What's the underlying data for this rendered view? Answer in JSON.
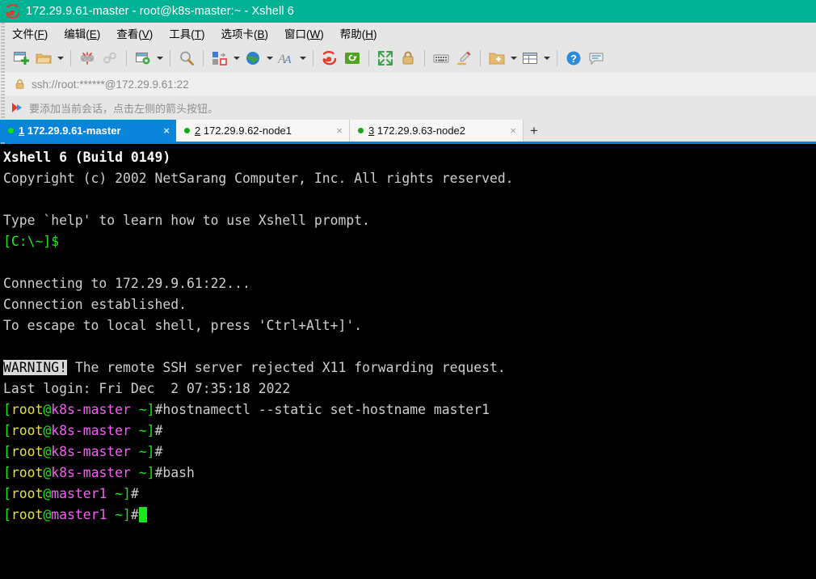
{
  "window": {
    "title": "172.29.9.61-master - root@k8s-master:~ - Xshell 6",
    "logo_icon": "xshell-spiral-logo",
    "titlebar_color": "#00b394"
  },
  "menubar": {
    "items": [
      {
        "name": "file",
        "pre": "文件(",
        "key": "F",
        "post": ")"
      },
      {
        "name": "edit",
        "pre": "编辑(",
        "key": "E",
        "post": ")"
      },
      {
        "name": "view",
        "pre": "查看(",
        "key": "V",
        "post": ")"
      },
      {
        "name": "tools",
        "pre": "工具(",
        "key": "T",
        "post": ")"
      },
      {
        "name": "tabs",
        "pre": "选项卡(",
        "key": "B",
        "post": ")"
      },
      {
        "name": "window",
        "pre": "窗口(",
        "key": "W",
        "post": ")"
      },
      {
        "name": "help",
        "pre": "帮助(",
        "key": "H",
        "post": ")"
      }
    ]
  },
  "toolbar": {
    "buttons": [
      {
        "icon": "new-session-icon",
        "dropdown": false
      },
      {
        "icon": "open-folder-icon",
        "dropdown": true
      },
      {
        "sep": true
      },
      {
        "icon": "disconnect-icon",
        "dropdown": false
      },
      {
        "icon": "reconnect-icon",
        "dropdown": false
      },
      {
        "sep": true
      },
      {
        "icon": "session-properties-icon",
        "dropdown": true
      },
      {
        "sep": true
      },
      {
        "icon": "find-icon",
        "dropdown": false
      },
      {
        "sep": true
      },
      {
        "icon": "layout-transfer-icon",
        "dropdown": true
      },
      {
        "icon": "globe-icon",
        "dropdown": true
      },
      {
        "icon": "font-icon",
        "dropdown": true
      },
      {
        "sep": true
      },
      {
        "icon": "xshell-logo-icon",
        "dropdown": false
      },
      {
        "icon": "xftp-icon",
        "dropdown": false
      },
      {
        "sep": true
      },
      {
        "icon": "fullscreen-icon",
        "dropdown": false
      },
      {
        "icon": "lock-icon",
        "dropdown": false
      },
      {
        "sep": true
      },
      {
        "icon": "keyboard-icon",
        "dropdown": false
      },
      {
        "icon": "highlight-pen-icon",
        "dropdown": false
      },
      {
        "sep": true
      },
      {
        "icon": "add-folder-icon",
        "dropdown": true
      },
      {
        "icon": "split-view-icon",
        "dropdown": true
      },
      {
        "sep": true
      },
      {
        "icon": "help-icon",
        "dropdown": false
      },
      {
        "icon": "chat-icon",
        "dropdown": false
      }
    ]
  },
  "address_bar": {
    "lock_icon": "lock-icon",
    "value": "ssh://root:******@172.29.9.61:22"
  },
  "hint_bar": {
    "icon": "red-arrow-icon",
    "text": "要添加当前会话，点击左侧的箭头按钮。"
  },
  "tabs": {
    "items": [
      {
        "index": "1",
        "label": "172.29.9.61-master",
        "active": true,
        "close": "×",
        "status": "connected"
      },
      {
        "index": "2",
        "label": "172.29.9.62-node1",
        "active": false,
        "close": "×",
        "status": "connected"
      },
      {
        "index": "3",
        "label": "172.29.9.63-node2",
        "active": false,
        "close": "×",
        "status": "connected"
      }
    ],
    "add_label": "+",
    "active_color": "#0a84d8"
  },
  "terminal": {
    "background": "#000000",
    "lines": [
      [
        {
          "t": "Xshell 6 (Build 0149)",
          "c": "bwhite"
        }
      ],
      [
        {
          "t": "Copyright (c) 2002 NetSarang Computer, Inc. All rights reserved.",
          "c": "white"
        }
      ],
      [
        {
          "t": "",
          "c": "white"
        }
      ],
      [
        {
          "t": "Type `help' to learn how to use Xshell prompt.",
          "c": "white"
        }
      ],
      [
        {
          "t": "[C:\\~]$",
          "c": "green"
        }
      ],
      [
        {
          "t": "",
          "c": "white"
        }
      ],
      [
        {
          "t": "Connecting to 172.29.9.61:22...",
          "c": "white"
        }
      ],
      [
        {
          "t": "Connection established.",
          "c": "white"
        }
      ],
      [
        {
          "t": "To escape to local shell, press 'Ctrl+Alt+]'.",
          "c": "white"
        }
      ],
      [
        {
          "t": "",
          "c": "white"
        }
      ],
      [
        {
          "t": "WARNING!",
          "c": "inv"
        },
        {
          "t": " The remote SSH server rejected X11 forwarding request.",
          "c": "white"
        }
      ],
      [
        {
          "t": "Last login: Fri Dec  2 07:35:18 2022",
          "c": "white"
        }
      ],
      [
        {
          "t": "[",
          "c": "green"
        },
        {
          "t": "root",
          "c": "yellow"
        },
        {
          "t": "@",
          "c": "green"
        },
        {
          "t": "k8s-master",
          "c": "magenta"
        },
        {
          "t": " ~]",
          "c": "green"
        },
        {
          "t": "#hostnamectl --static set-hostname master1",
          "c": "white"
        }
      ],
      [
        {
          "t": "[",
          "c": "green"
        },
        {
          "t": "root",
          "c": "yellow"
        },
        {
          "t": "@",
          "c": "green"
        },
        {
          "t": "k8s-master",
          "c": "magenta"
        },
        {
          "t": " ~]",
          "c": "green"
        },
        {
          "t": "#",
          "c": "white"
        }
      ],
      [
        {
          "t": "[",
          "c": "green"
        },
        {
          "t": "root",
          "c": "yellow"
        },
        {
          "t": "@",
          "c": "green"
        },
        {
          "t": "k8s-master",
          "c": "magenta"
        },
        {
          "t": " ~]",
          "c": "green"
        },
        {
          "t": "#",
          "c": "white"
        }
      ],
      [
        {
          "t": "[",
          "c": "green"
        },
        {
          "t": "root",
          "c": "yellow"
        },
        {
          "t": "@",
          "c": "green"
        },
        {
          "t": "k8s-master",
          "c": "magenta"
        },
        {
          "t": " ~]",
          "c": "green"
        },
        {
          "t": "#bash",
          "c": "white"
        }
      ],
      [
        {
          "t": "[",
          "c": "green"
        },
        {
          "t": "root",
          "c": "yellow"
        },
        {
          "t": "@",
          "c": "green"
        },
        {
          "t": "master1",
          "c": "magenta"
        },
        {
          "t": " ~]",
          "c": "green"
        },
        {
          "t": "#",
          "c": "white"
        }
      ],
      [
        {
          "t": "[",
          "c": "green"
        },
        {
          "t": "root",
          "c": "yellow"
        },
        {
          "t": "@",
          "c": "green"
        },
        {
          "t": "master1",
          "c": "magenta"
        },
        {
          "t": " ~]",
          "c": "green"
        },
        {
          "t": "#",
          "c": "white"
        },
        {
          "cursor": true
        }
      ]
    ]
  }
}
